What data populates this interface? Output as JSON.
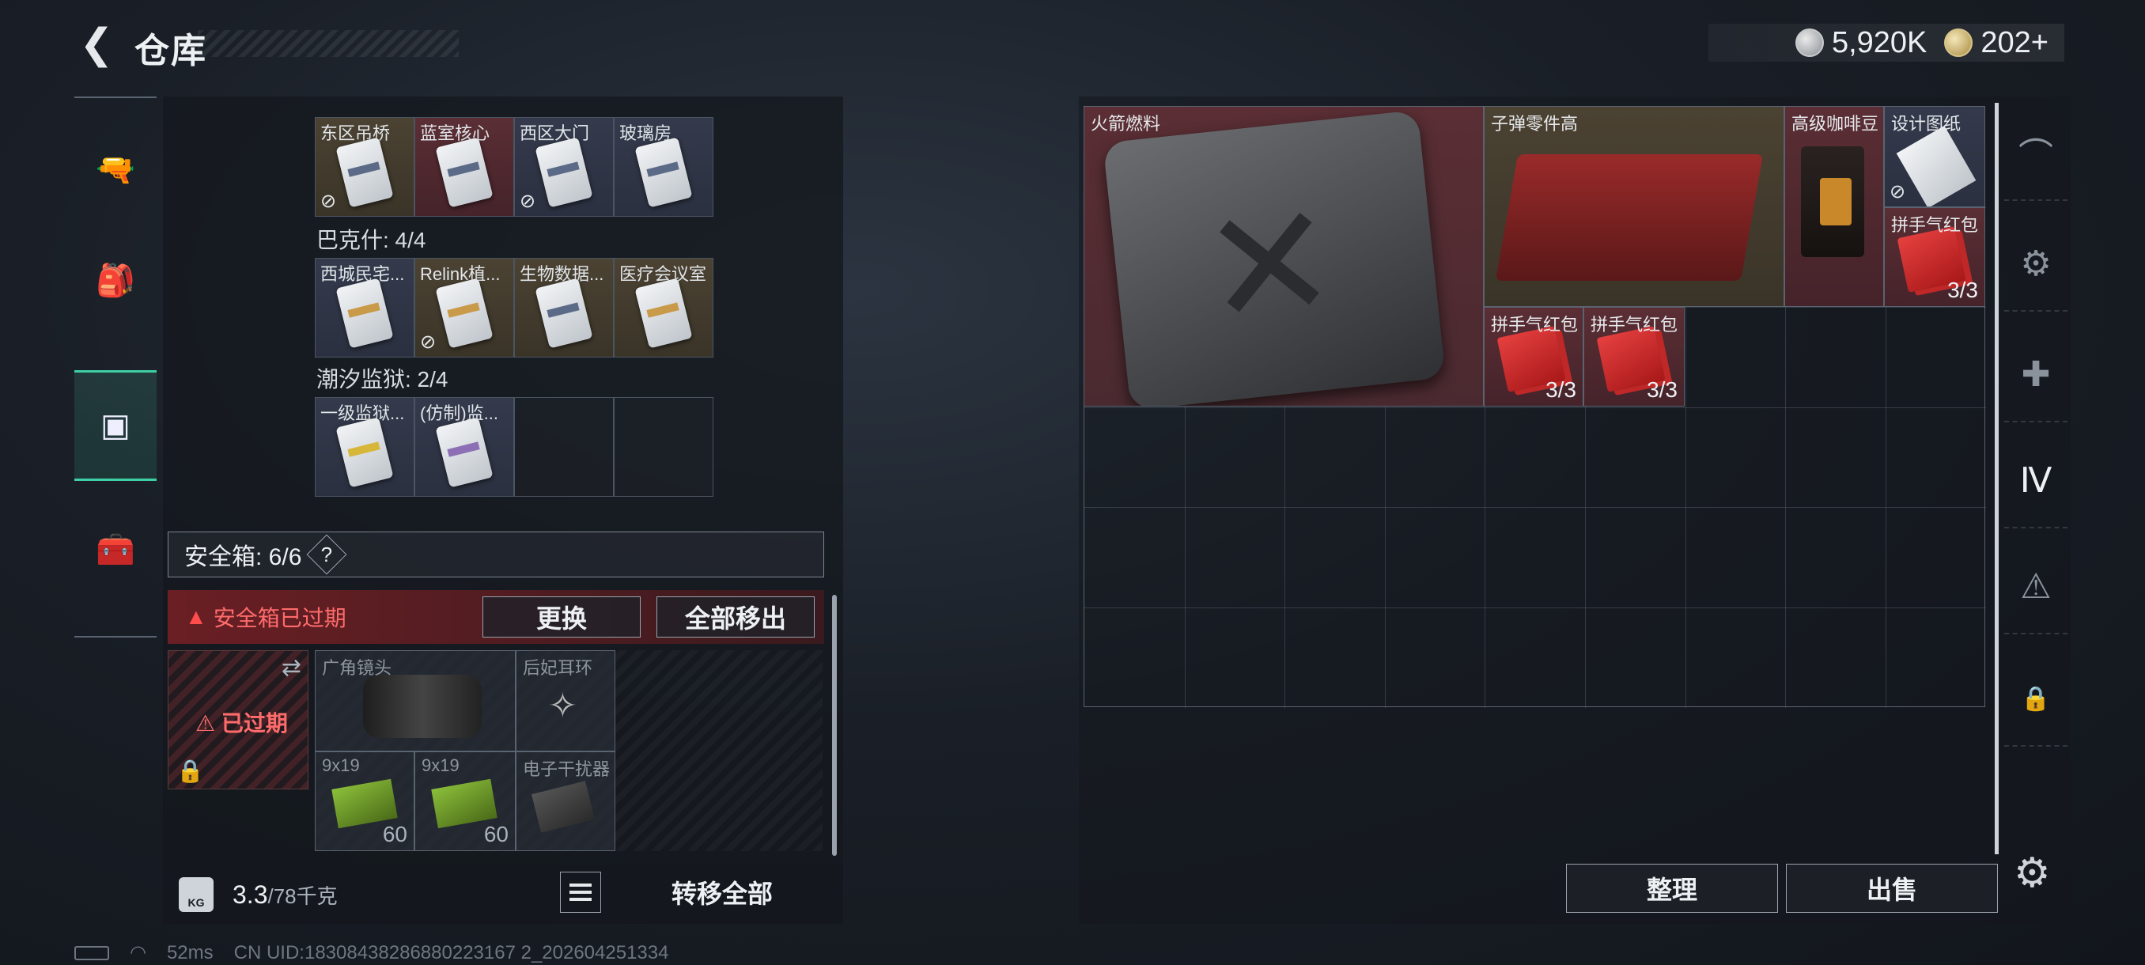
{
  "header": {
    "title": "仓库",
    "back_icon": "back-arrow-icon",
    "currency": [
      {
        "icon": "silver-coin-icon",
        "value": "5,920K"
      },
      {
        "icon": "gold-coin-icon",
        "value": "202+"
      }
    ]
  },
  "left_nav": {
    "items": [
      {
        "icon": "gun-icon",
        "active": false
      },
      {
        "icon": "backpack-icon",
        "active": false
      },
      {
        "icon": "keycard-case-icon",
        "active": true
      },
      {
        "icon": "toolbox-icon",
        "active": false
      }
    ]
  },
  "key_groups": [
    {
      "label": "",
      "slots": [
        {
          "label": "东区吊桥",
          "tint": "gold",
          "unbound": true,
          "card": "blue"
        },
        {
          "label": "蓝室核心",
          "tint": "red",
          "unbound": false,
          "card": "blue"
        },
        {
          "label": "西区大门",
          "tint": "blue",
          "unbound": true,
          "card": "blue"
        },
        {
          "label": "玻璃房",
          "tint": "blue",
          "unbound": false,
          "card": "blue"
        }
      ]
    },
    {
      "label": "巴克什: 4/4",
      "slots": [
        {
          "label": "西城民宅...",
          "tint": "blue",
          "unbound": false,
          "card": "orange"
        },
        {
          "label": "Relink植...",
          "tint": "gold",
          "unbound": true,
          "card": "orange"
        },
        {
          "label": "生物数据...",
          "tint": "gold",
          "unbound": false,
          "card": "blue"
        },
        {
          "label": "医疗会议室",
          "tint": "gold",
          "unbound": false,
          "card": "orange"
        }
      ]
    },
    {
      "label": "潮汐监狱: 2/4",
      "slots": [
        {
          "label": "一级监狱...",
          "tint": "blue",
          "unbound": false,
          "card": "yellow"
        },
        {
          "label": "(仿制)监...",
          "tint": "blue",
          "unbound": false,
          "card": "purple"
        },
        {
          "label": "",
          "tint": "empty",
          "unbound": false,
          "card": ""
        },
        {
          "label": "",
          "tint": "empty",
          "unbound": false,
          "card": ""
        }
      ]
    }
  ],
  "safe_box": {
    "label": "安全箱: 6/6",
    "help": "?",
    "expired_notice": "安全箱已过期",
    "replace_button": "更换",
    "move_all_button": "全部移出",
    "slot_status": "已过期",
    "items": [
      {
        "label": "广角镜头",
        "count": ""
      },
      {
        "label": "后妃耳环",
        "count": ""
      },
      {
        "label": "9x19",
        "count": "60"
      },
      {
        "label": "9x19",
        "count": "60"
      },
      {
        "label": "电子干扰器",
        "count": ""
      }
    ]
  },
  "footer_left": {
    "kg_label": "KG",
    "weight": "3.3",
    "weight_max": "/78千克",
    "transfer_all": "转移全部"
  },
  "status": {
    "ping": "52ms",
    "uid": "CN UID:18308438286880223167 2_202604251334"
  },
  "stash": {
    "items": [
      {
        "label": "火箭燃料",
        "count": ""
      },
      {
        "label": "子弹零件高",
        "count": ""
      },
      {
        "label": "高级咖啡豆",
        "count": ""
      },
      {
        "label": "设计图纸",
        "count": ""
      },
      {
        "label": "拼手气红包",
        "count": "3/3"
      },
      {
        "label": "拼手气红包",
        "count": "3/3"
      },
      {
        "label": "拼手气红包",
        "count": "3/3"
      }
    ],
    "sort_button": "整理",
    "sell_button": "出售"
  },
  "right_nav": {
    "items": [
      {
        "icon": "arch-icon"
      },
      {
        "icon": "camera-machine-icon"
      },
      {
        "icon": "medkit-plus-icon"
      },
      {
        "icon": "tier-iv-device-icon"
      },
      {
        "icon": "warning-crate-icon"
      },
      {
        "icon": "lock-icon"
      }
    ],
    "settings_icon": "gear-icon"
  },
  "colors": {
    "accent_green": "#3fcfa5",
    "alert_red": "#ff4d4d",
    "rarity_gold": "#4b4232",
    "rarity_red": "#5a2e34",
    "rarity_blue": "#343a4c"
  }
}
